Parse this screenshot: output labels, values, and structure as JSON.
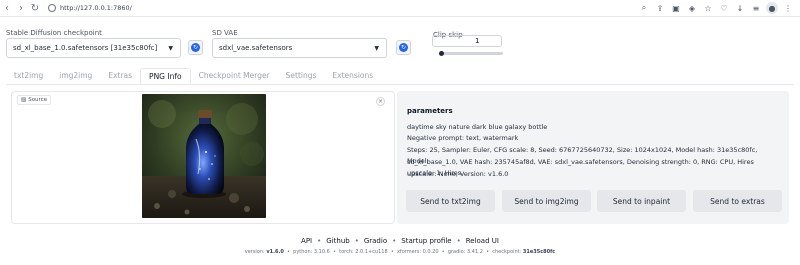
{
  "browser": {
    "url": "http://127.0.0.1:7860/"
  },
  "checkpoint": {
    "label": "Stable Diffusion checkpoint",
    "value": "sd_xl_base_1.0.safetensors [31e35c80fc]"
  },
  "vae": {
    "label": "SD VAE",
    "value": "sdxl_vae.safetensors"
  },
  "clip_skip": {
    "label": "Clip skip",
    "value": "1",
    "slider_fraction": 0.0
  },
  "tabs": [
    {
      "label": "txt2img"
    },
    {
      "label": "img2img"
    },
    {
      "label": "Extras"
    },
    {
      "label": "PNG Info"
    },
    {
      "label": "Checkpoint Merger"
    },
    {
      "label": "Settings"
    },
    {
      "label": "Extensions"
    }
  ],
  "image_panel": {
    "source_label": "Source",
    "close_glyph": "×"
  },
  "parameters": {
    "title": "parameters",
    "prompt": "daytime sky nature dark blue galaxy bottle",
    "negative": "Negative prompt: text, watermark",
    "steps_line1": "Steps: 25, Sampler: Euler, CFG scale: 8, Seed: 6767725640732, Size: 1024x1024, Model hash: 31e35c80fc, Model:",
    "steps_line2": "sd_xl_base_1.0, VAE hash: 235745af8d, VAE: sdxl_vae.safetensors, Denoising strength: 0, RNG: CPU, Hires upscale: 1, Hires",
    "steps_line3": "upscaler: None, Version: v1.6.0"
  },
  "send_buttons": {
    "txt2img": "Send to txt2img",
    "img2img": "Send to img2img",
    "inpaint": "Send to inpaint",
    "extras": "Send to extras"
  },
  "footer": {
    "links": [
      "API",
      "Github",
      "Gradio",
      "Startup profile",
      "Reload UI"
    ],
    "separator": "•"
  },
  "versions": {
    "version_label": "version:",
    "version": "v1.6.0",
    "python": "python: 3.10.6",
    "torch": "torch: 2.0.1+cu118",
    "xformers": "xformers: 0.0.20",
    "gradio": "gradio: 3.41.2",
    "checkpoint_label": "checkpoint:",
    "checkpoint": "31e35c80fc"
  }
}
